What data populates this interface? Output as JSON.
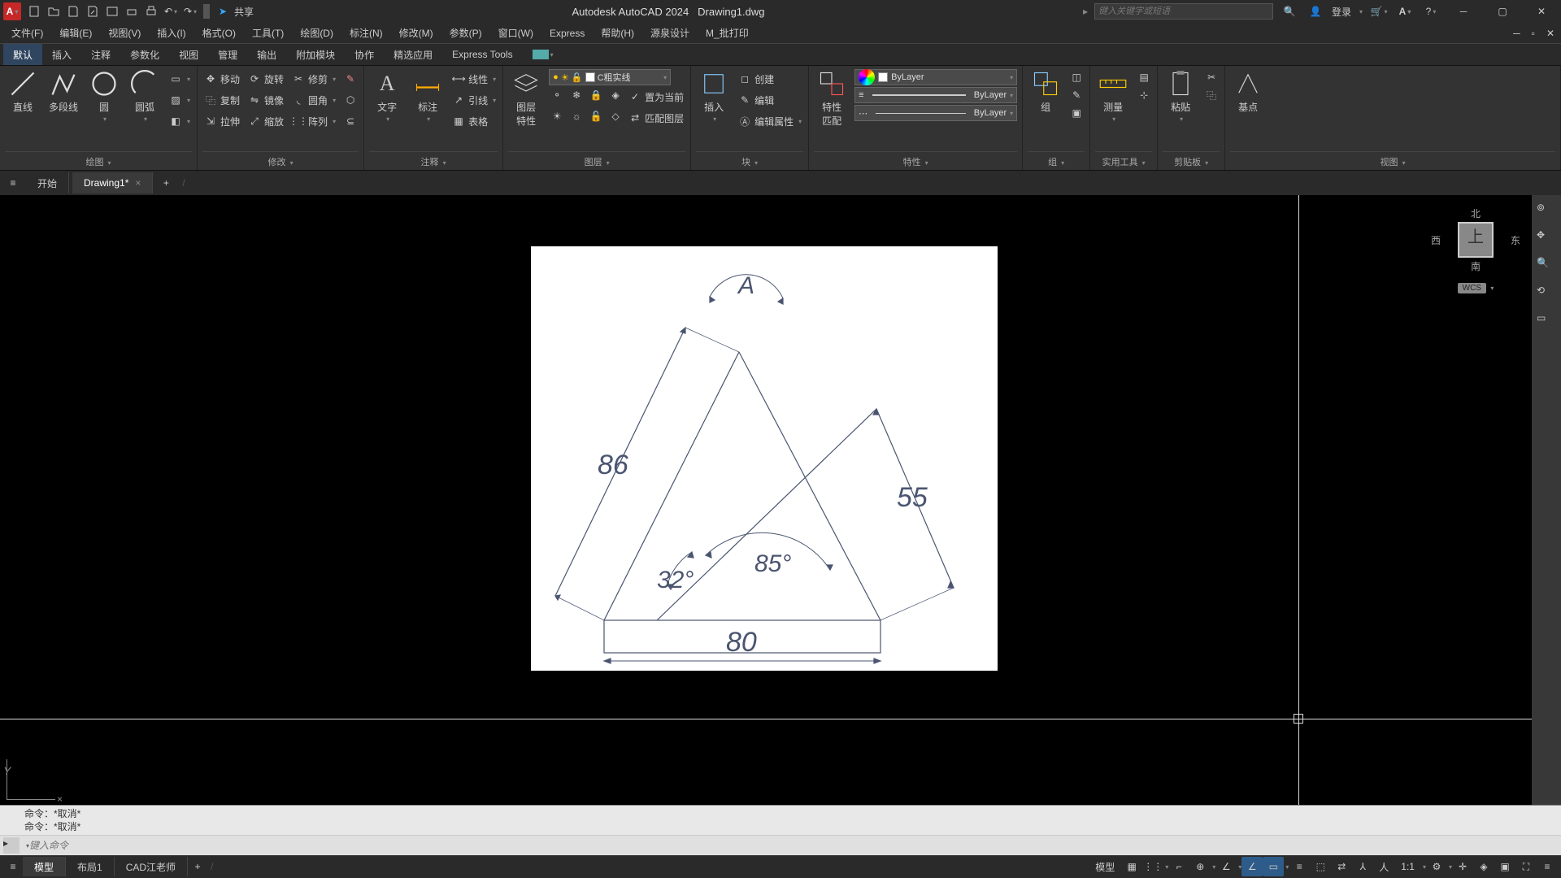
{
  "app": {
    "logo_letter": "A",
    "title_app": "Autodesk AutoCAD 2024",
    "title_file": "Drawing1.dwg",
    "search_placeholder": "键入关键字或短语",
    "share_label": "共享",
    "login_label": "登录"
  },
  "menubar": {
    "items": [
      "文件(F)",
      "编辑(E)",
      "视图(V)",
      "插入(I)",
      "格式(O)",
      "工具(T)",
      "绘图(D)",
      "标注(N)",
      "修改(M)",
      "参数(P)",
      "窗口(W)",
      "Express",
      "帮助(H)",
      "源泉设计",
      "M_批打印"
    ]
  },
  "ribbon_tabs": [
    "默认",
    "插入",
    "注释",
    "参数化",
    "视图",
    "管理",
    "输出",
    "附加模块",
    "协作",
    "精选应用",
    "Express Tools"
  ],
  "ribbon": {
    "draw": {
      "line": "直线",
      "polyline": "多段线",
      "circle": "圆",
      "arc": "圆弧",
      "title": "绘图"
    },
    "modify": {
      "move": "移动",
      "rotate": "旋转",
      "trim": "修剪",
      "copy": "复制",
      "mirror": "镜像",
      "fillet": "圆角",
      "stretch": "拉伸",
      "scale": "缩放",
      "array": "阵列",
      "title": "修改"
    },
    "annot": {
      "text": "文字",
      "dim": "标注",
      "linear": "线性",
      "leader": "引线",
      "table": "表格",
      "title": "注释"
    },
    "layers": {
      "layer_props": "图层\n特性",
      "set_current": "置为当前",
      "match_layer": "匹配图层",
      "current_layer": "C粗实线",
      "title": "图层"
    },
    "block": {
      "insert": "插入",
      "create": "创建",
      "edit": "编辑",
      "edit_attr": "编辑属性",
      "title": "块"
    },
    "props": {
      "match": "特性\n匹配",
      "color_bylayer": "ByLayer",
      "lt_bylayer": "ByLayer",
      "lw_bylayer": "ByLayer",
      "title": "特性"
    },
    "groups": {
      "group": "组",
      "title": "组"
    },
    "utils": {
      "measure": "测量",
      "title": "实用工具"
    },
    "clip": {
      "paste": "粘贴",
      "title": "剪贴板"
    },
    "view": {
      "base": "基点",
      "title": "视图"
    }
  },
  "file_tabs": {
    "start": "开始",
    "drawing": "Drawing1*"
  },
  "drawing": {
    "dim_86": "86",
    "dim_55": "55",
    "dim_80": "80",
    "ang_32": "32°",
    "ang_85": "85°",
    "ang_A": "A",
    "ucs_y": "Y"
  },
  "viewcube": {
    "n": "北",
    "s": "南",
    "e": "东",
    "w": "西",
    "top": "上",
    "wcs": "WCS"
  },
  "cmd": {
    "line1": "命令：*取消*",
    "line2": "命令：*取消*",
    "placeholder": "键入命令"
  },
  "layout_tabs": [
    "模型",
    "布局1",
    "CAD江老师"
  ],
  "status": {
    "model": "模型",
    "scale": "1:1"
  }
}
